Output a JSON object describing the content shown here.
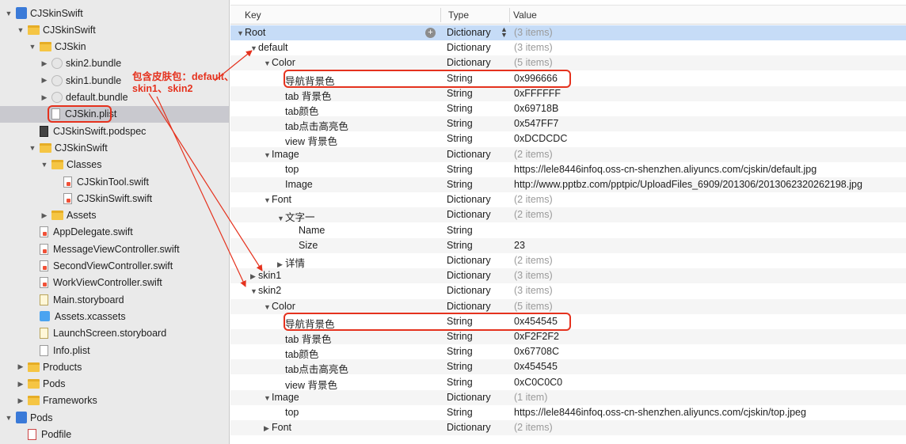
{
  "navigator": {
    "items": [
      {
        "label": "CJSkinSwift",
        "icon": "project-icon",
        "depth": 0,
        "disc": "▼"
      },
      {
        "label": "CJSkinSwift",
        "icon": "folder-icon",
        "depth": 1,
        "disc": "▼"
      },
      {
        "label": "CJSkin",
        "icon": "folder-icon",
        "depth": 2,
        "disc": "▼"
      },
      {
        "label": "skin2.bundle",
        "icon": "bundle-icon",
        "depth": 3,
        "disc": "▶"
      },
      {
        "label": "skin1.bundle",
        "icon": "bundle-icon",
        "depth": 3,
        "disc": "▶"
      },
      {
        "label": "default.bundle",
        "icon": "bundle-icon",
        "depth": 3,
        "disc": "▶"
      },
      {
        "label": "CJSkin.plist",
        "icon": "plist-file-icon",
        "depth": 3,
        "disc": "",
        "selected": true
      },
      {
        "label": "CJSkinSwift.podspec",
        "icon": "podspec-file-icon",
        "depth": 2,
        "disc": ""
      },
      {
        "label": "CJSkinSwift",
        "icon": "folder-icon",
        "depth": 2,
        "disc": "▼"
      },
      {
        "label": "Classes",
        "icon": "folder-icon",
        "depth": 3,
        "disc": "▼"
      },
      {
        "label": "CJSkinTool.swift",
        "icon": "swift-file-icon",
        "depth": 4,
        "disc": ""
      },
      {
        "label": "CJSkinSwift.swift",
        "icon": "swift-file-icon",
        "depth": 4,
        "disc": ""
      },
      {
        "label": "Assets",
        "icon": "folder-icon",
        "depth": 3,
        "disc": "▶"
      },
      {
        "label": "AppDelegate.swift",
        "icon": "swift-file-icon",
        "depth": 2,
        "disc": ""
      },
      {
        "label": "MessageViewController.swift",
        "icon": "swift-file-icon",
        "depth": 2,
        "disc": ""
      },
      {
        "label": "SecondViewController.swift",
        "icon": "swift-file-icon",
        "depth": 2,
        "disc": ""
      },
      {
        "label": "WorkViewController.swift",
        "icon": "swift-file-icon",
        "depth": 2,
        "disc": ""
      },
      {
        "label": "Main.storyboard",
        "icon": "storyboard-file-icon",
        "depth": 2,
        "disc": ""
      },
      {
        "label": "Assets.xcassets",
        "icon": "xcassets-icon",
        "depth": 2,
        "disc": ""
      },
      {
        "label": "LaunchScreen.storyboard",
        "icon": "storyboard-file-icon",
        "depth": 2,
        "disc": ""
      },
      {
        "label": "Info.plist",
        "icon": "plist-file-icon",
        "depth": 2,
        "disc": ""
      },
      {
        "label": "Products",
        "icon": "folder-icon",
        "depth": 1,
        "disc": "▶"
      },
      {
        "label": "Pods",
        "icon": "folder-icon",
        "depth": 1,
        "disc": "▶"
      },
      {
        "label": "Frameworks",
        "icon": "folder-icon",
        "depth": 1,
        "disc": "▶"
      },
      {
        "label": "Pods",
        "icon": "project-icon",
        "depth": 0,
        "disc": "▼"
      },
      {
        "label": "Podfile",
        "icon": "podfile-icon",
        "depth": 1,
        "disc": ""
      }
    ]
  },
  "plist": {
    "headers": {
      "key": "Key",
      "type": "Type",
      "value": "Value"
    },
    "rows": [
      {
        "key": "Root",
        "type": "Dictionary",
        "value": "(3 items)",
        "depth": 0,
        "disc": "▼",
        "gray": true,
        "root": true
      },
      {
        "key": "default",
        "type": "Dictionary",
        "value": "(3 items)",
        "depth": 1,
        "disc": "▼",
        "gray": true
      },
      {
        "key": "Color",
        "type": "Dictionary",
        "value": "(5 items)",
        "depth": 2,
        "disc": "▼",
        "gray": true
      },
      {
        "key": "导航背景色",
        "type": "String",
        "value": "0x996666",
        "depth": 3,
        "disc": ""
      },
      {
        "key": "tab 背景色",
        "type": "String",
        "value": "0xFFFFFF",
        "depth": 3,
        "disc": ""
      },
      {
        "key": "tab颜色",
        "type": "String",
        "value": "0x69718B",
        "depth": 3,
        "disc": ""
      },
      {
        "key": "tab点击高亮色",
        "type": "String",
        "value": "0x547FF7",
        "depth": 3,
        "disc": ""
      },
      {
        "key": "view 背景色",
        "type": "String",
        "value": "0xDCDCDC",
        "depth": 3,
        "disc": ""
      },
      {
        "key": "Image",
        "type": "Dictionary",
        "value": "(2 items)",
        "depth": 2,
        "disc": "▼",
        "gray": true
      },
      {
        "key": "top",
        "type": "String",
        "value": "https://lele8446infoq.oss-cn-shenzhen.aliyuncs.com/cjskin/default.jpg",
        "depth": 3,
        "disc": ""
      },
      {
        "key": "Image",
        "type": "String",
        "value": "http://www.pptbz.com/pptpic/UploadFiles_6909/201306/2013062320262198.jpg",
        "depth": 3,
        "disc": ""
      },
      {
        "key": "Font",
        "type": "Dictionary",
        "value": "(2 items)",
        "depth": 2,
        "disc": "▼",
        "gray": true
      },
      {
        "key": "文字一",
        "type": "Dictionary",
        "value": "(2 items)",
        "depth": 3,
        "disc": "▼",
        "gray": true
      },
      {
        "key": "Name",
        "type": "String",
        "value": "",
        "depth": 4,
        "disc": ""
      },
      {
        "key": "Size",
        "type": "String",
        "value": "23",
        "depth": 4,
        "disc": ""
      },
      {
        "key": "详情",
        "type": "Dictionary",
        "value": "(2 items)",
        "depth": 3,
        "disc": "▶",
        "gray": true
      },
      {
        "key": "skin1",
        "type": "Dictionary",
        "value": "(3 items)",
        "depth": 1,
        "disc": "▶",
        "gray": true
      },
      {
        "key": "skin2",
        "type": "Dictionary",
        "value": "(3 items)",
        "depth": 1,
        "disc": "▼",
        "gray": true
      },
      {
        "key": "Color",
        "type": "Dictionary",
        "value": "(5 items)",
        "depth": 2,
        "disc": "▼",
        "gray": true
      },
      {
        "key": "导航背景色",
        "type": "String",
        "value": "0x454545",
        "depth": 3,
        "disc": ""
      },
      {
        "key": "tab 背景色",
        "type": "String",
        "value": "0xF2F2F2",
        "depth": 3,
        "disc": ""
      },
      {
        "key": "tab颜色",
        "type": "String",
        "value": "0x67708C",
        "depth": 3,
        "disc": ""
      },
      {
        "key": "tab点击高亮色",
        "type": "String",
        "value": "0x454545",
        "depth": 3,
        "disc": ""
      },
      {
        "key": "view 背景色",
        "type": "String",
        "value": "0xC0C0C0",
        "depth": 3,
        "disc": ""
      },
      {
        "key": "Image",
        "type": "Dictionary",
        "value": "(1 item)",
        "depth": 2,
        "disc": "▼",
        "gray": true
      },
      {
        "key": "top",
        "type": "String",
        "value": "https://lele8446infoq.oss-cn-shenzhen.aliyuncs.com/cjskin/top.jpeg",
        "depth": 3,
        "disc": ""
      },
      {
        "key": "Font",
        "type": "Dictionary",
        "value": "(2 items)",
        "depth": 2,
        "disc": "▶",
        "gray": true
      }
    ]
  },
  "annotation": {
    "line1": "包含皮肤包：default、",
    "line2": "skin1、skin2",
    "color": "#e5321e"
  }
}
